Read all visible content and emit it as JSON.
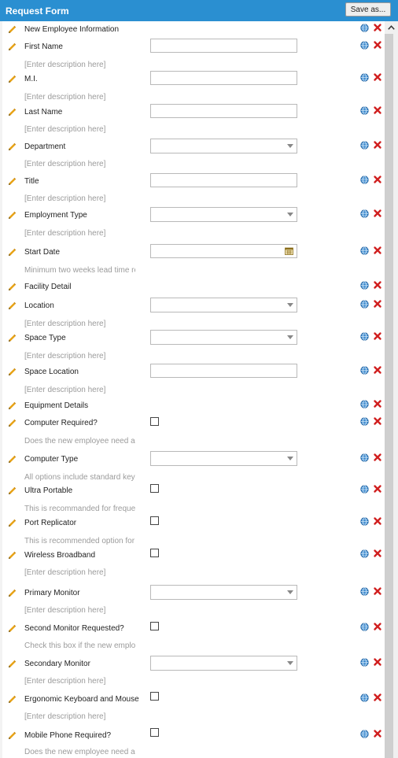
{
  "header": {
    "title": "Request Form",
    "save_label": "Save as..."
  },
  "sections": {
    "new_employee": "New Employee Information",
    "facility": "Facility Detail",
    "equipment": "Equipment Details"
  },
  "fields": {
    "first_name": {
      "label": "First Name",
      "desc": "[Enter description here]"
    },
    "mi": {
      "label": "M.I.",
      "desc": "[Enter description here]"
    },
    "last_name": {
      "label": "Last Name",
      "desc": "[Enter description here]"
    },
    "department": {
      "label": "Department",
      "desc": "[Enter description here]"
    },
    "title": {
      "label": "Title",
      "desc": "[Enter description here]"
    },
    "employment_type": {
      "label": "Employment Type",
      "desc": "[Enter description here]"
    },
    "start_date": {
      "label": "Start Date",
      "desc": "Minimum two weeks lead time re"
    },
    "location": {
      "label": "Location",
      "desc": "[Enter description here]"
    },
    "space_type": {
      "label": "Space Type",
      "desc": "[Enter description here]"
    },
    "space_location": {
      "label": "Space Location",
      "desc": "[Enter description here]"
    },
    "computer_required": {
      "label": "Computer Required?",
      "desc": "Does the new employee need a c"
    },
    "computer_type": {
      "label": "Computer Type",
      "desc": "All options include standard keyb"
    },
    "ultra_portable": {
      "label": "Ultra Portable",
      "desc": "This is recommanded for frequer"
    },
    "port_replicator": {
      "label": "Port Replicator",
      "desc": "This is recommended option for a"
    },
    "wireless_broadband": {
      "label": "Wireless Broadband",
      "desc": "[Enter description here]"
    },
    "primary_monitor": {
      "label": "Primary Monitor",
      "desc": "[Enter description here]"
    },
    "second_monitor_requested": {
      "label": "Second Monitor Requested?",
      "desc": "Check this box if the new employ"
    },
    "secondary_monitor": {
      "label": "Secondary Monitor",
      "desc": "[Enter description here]"
    },
    "ergonomic": {
      "label": "Ergonomic Keyboard and Mouse",
      "desc": "[Enter description here]"
    },
    "mobile_phone": {
      "label": "Mobile Phone Required?",
      "desc": "Does the new employee need a"
    }
  },
  "colors": {
    "header": "#2a8fd1",
    "delete": "#d01f1f",
    "globe": "#1f6fb5",
    "pencil": "#e8a317",
    "desc_text": "#9b9b9b"
  },
  "icons": {
    "edit": "pencil-icon",
    "localize": "globe-icon",
    "delete": "close-icon",
    "calendar": "calendar-icon",
    "scroll_up": "chevron-up-icon"
  }
}
